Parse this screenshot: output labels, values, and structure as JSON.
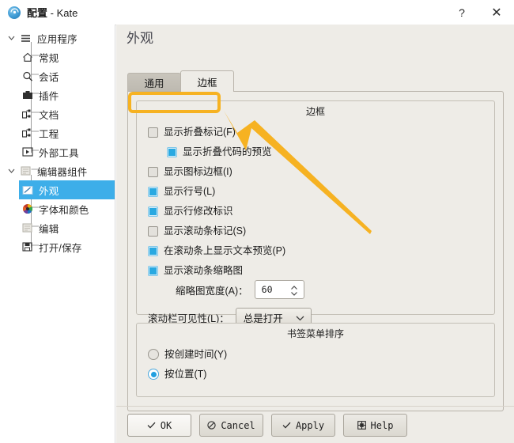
{
  "window": {
    "title_bold": "配置",
    "title_rest": " - Kate",
    "app_icon": "kate-app-icon",
    "help_button": "?",
    "close_button": "✕"
  },
  "sidebar": {
    "items": [
      {
        "label": "应用程序",
        "icon": "hamburger-menu-icon",
        "level": 0,
        "expanded": true,
        "selected": false
      },
      {
        "label": "常规",
        "icon": "home-icon",
        "level": 1,
        "selected": false
      },
      {
        "label": "会话",
        "icon": "search-icon",
        "level": 1,
        "selected": false
      },
      {
        "label": "插件",
        "icon": "plugin-icon",
        "level": 1,
        "selected": false
      },
      {
        "label": "文档",
        "icon": "documents-icon",
        "level": 1,
        "selected": false
      },
      {
        "label": "工程",
        "icon": "project-icon",
        "level": 1,
        "selected": false
      },
      {
        "label": "外部工具",
        "icon": "external-tool-icon",
        "level": 1,
        "selected": false
      },
      {
        "label": "编辑器组件",
        "icon": "editor-component-icon",
        "level": 0,
        "expanded": true,
        "selected": false
      },
      {
        "label": "外观",
        "icon": "appearance-icon",
        "level": 1,
        "selected": true
      },
      {
        "label": "字体和颜色",
        "icon": "color-wheel-icon",
        "level": 1,
        "selected": false
      },
      {
        "label": "编辑",
        "icon": "edit-document-icon",
        "level": 1,
        "selected": false
      },
      {
        "label": "打开/保存",
        "icon": "floppy-disk-icon",
        "level": 1,
        "selected": false
      }
    ]
  },
  "main": {
    "page_title": "外观",
    "tabs": [
      {
        "label": "通用",
        "active": false
      },
      {
        "label": "边框",
        "active": true
      }
    ],
    "border_group": {
      "title": "边框",
      "checkboxes": [
        {
          "label": "显示折叠标记(F)",
          "checked": false,
          "indented": false,
          "highlighted": true
        },
        {
          "label": "显示折叠代码的预览",
          "checked": true,
          "indented": true,
          "highlighted": false
        },
        {
          "label": "显示图标边框(I)",
          "checked": false,
          "indented": false,
          "highlighted": false
        },
        {
          "label": "显示行号(L)",
          "checked": true,
          "indented": false,
          "highlighted": false
        },
        {
          "label": "显示行修改标识",
          "checked": true,
          "indented": false,
          "highlighted": false
        },
        {
          "label": "显示滚动条标记(S)",
          "checked": false,
          "indented": false,
          "highlighted": false
        },
        {
          "label": "在滚动条上显示文本预览(P)",
          "checked": true,
          "indented": false,
          "highlighted": false
        },
        {
          "label": "显示滚动条缩略图",
          "checked": true,
          "indented": false,
          "highlighted": false
        }
      ],
      "spin": {
        "label": "缩略图宽度(A)：",
        "value": "60"
      },
      "combo": {
        "label": "滚动栏可见性(L)：",
        "value": "总是打开"
      }
    },
    "bookmark_group": {
      "title": "书签菜单排序",
      "radios": [
        {
          "label": "按创建时间(Y)",
          "selected": false
        },
        {
          "label": "按位置(T)",
          "selected": true
        }
      ]
    },
    "buttons": [
      {
        "label": "OK",
        "icon": "check-icon",
        "default": true
      },
      {
        "label": "Cancel",
        "icon": "cancel-icon",
        "default": false
      },
      {
        "label": "Apply",
        "icon": "check-icon",
        "default": false
      },
      {
        "label": "Help",
        "icon": "help-book-icon",
        "default": false
      }
    ]
  },
  "annotation": {
    "highlight_color": "#f6b222",
    "arrow_color": "#f6b222",
    "arrow_target": "显示折叠标记(F)"
  }
}
